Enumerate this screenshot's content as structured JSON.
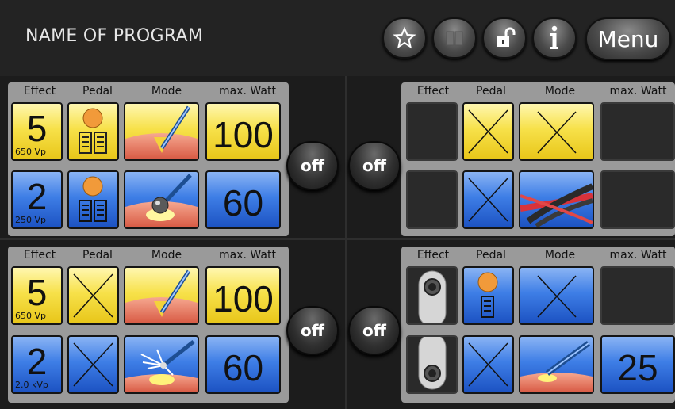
{
  "header": {
    "title": "NAME OF PROGRAM",
    "menu_label": "Menu",
    "icons": [
      "star-icon",
      "book-icon",
      "unlock-icon",
      "info-icon"
    ]
  },
  "columns": {
    "effect": "Effect",
    "pedal": "Pedal",
    "mode": "Mode",
    "watt": "max. Watt"
  },
  "panels": [
    {
      "rows": [
        {
          "effect": "5",
          "effect_sub": "650 Vp",
          "watt": "100",
          "color": "yellow"
        },
        {
          "effect": "2",
          "effect_sub": "250 Vp",
          "watt": "60",
          "color": "blue"
        }
      ],
      "off_label": "off"
    },
    {
      "rows": [
        {
          "effect": "",
          "effect_sub": "",
          "watt": "",
          "color": "yellow"
        },
        {
          "effect": "",
          "effect_sub": "",
          "watt": "",
          "color": "blue"
        }
      ],
      "off_label": "off"
    },
    {
      "rows": [
        {
          "effect": "5",
          "effect_sub": "650 Vp",
          "watt": "100",
          "color": "yellow"
        },
        {
          "effect": "2",
          "effect_sub": "2.0 kVp",
          "watt": "60",
          "color": "blue"
        }
      ],
      "off_label": "off"
    },
    {
      "rows": [
        {
          "effect": "",
          "effect_sub": "",
          "watt": "",
          "color": "blue"
        },
        {
          "effect": "",
          "effect_sub": "",
          "watt": "25",
          "color": "blue"
        }
      ],
      "off_label": "off"
    }
  ],
  "colors": {
    "yellow": "#f7e14a",
    "blue": "#3e7ee6",
    "background": "#1c1c1c"
  }
}
